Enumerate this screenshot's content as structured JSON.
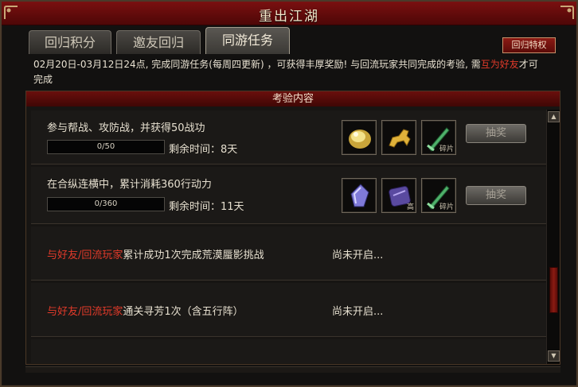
{
  "window": {
    "title": "重出江湖"
  },
  "tabs": [
    {
      "label": "回归积分"
    },
    {
      "label": "邀友回归"
    },
    {
      "label": "同游任务"
    }
  ],
  "special_button": "回归特权",
  "description": {
    "part1": "02月20日-03月12日24点, 完成同游任务(每周四更新) ，可获得丰厚奖励! 与回流玩家共同完成的考验, 需",
    "highlight": "互为好友",
    "part2": "才可完成"
  },
  "panel": {
    "header": "考验内容"
  },
  "tasks": [
    {
      "text": "参与帮战、攻防战，并获得50战功",
      "progress": "0/50",
      "progress_fraction": 0,
      "remaining": "剩余时间：8天",
      "rewards": [
        {
          "icon": "gold-ore-icon",
          "tag": ""
        },
        {
          "icon": "golden-horse-icon",
          "tag": ""
        },
        {
          "icon": "jade-sword-fragment-icon",
          "tag": "碎片"
        }
      ],
      "button": "抽奖"
    },
    {
      "text": "在合纵连横中，累计消耗360行动力",
      "progress": "0/360",
      "progress_fraction": 0,
      "remaining": "剩余时间：11天",
      "rewards": [
        {
          "icon": "purple-crystal-icon",
          "tag": ""
        },
        {
          "icon": "purple-stone-icon",
          "tag": "高"
        },
        {
          "icon": "jade-sword-fragment-icon",
          "tag": "碎片"
        }
      ],
      "button": "抽奖"
    },
    {
      "prefix": "与好友/回流玩家",
      "text": "累计成功1次完成荒漠蜃影挑战",
      "status": "尚未开启..."
    },
    {
      "prefix": "与好友/回流玩家",
      "text": "通关寻芳1次（含五行阵）",
      "status": "尚未开启..."
    }
  ],
  "scrollbar": {
    "up_icon": "arrow-up-icon",
    "down_icon": "arrow-down-icon"
  },
  "colors": {
    "title_red": "#7a1010",
    "highlight_red": "#e23a2a",
    "panel_bg": "#171513"
  }
}
